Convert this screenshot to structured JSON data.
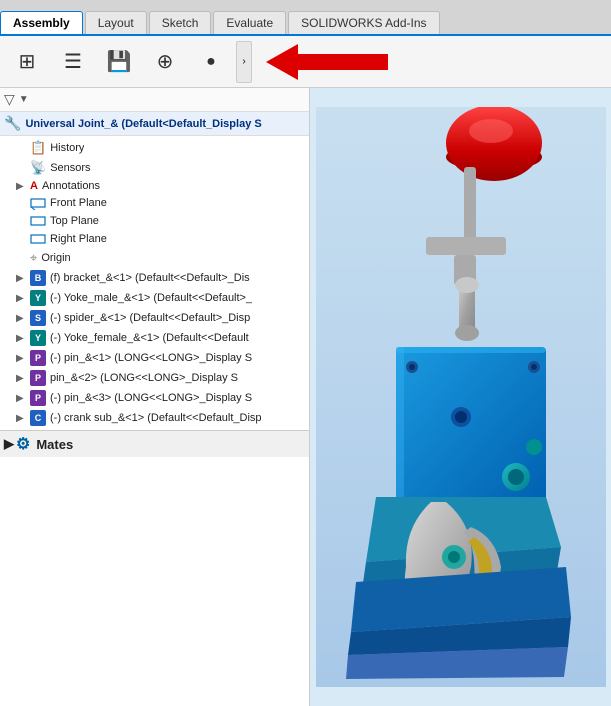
{
  "tabs": [
    {
      "label": "Assembly",
      "active": true
    },
    {
      "label": "Layout",
      "active": false
    },
    {
      "label": "Sketch",
      "active": false
    },
    {
      "label": "Evaluate",
      "active": false
    },
    {
      "label": "SOLIDWORKS Add-Ins",
      "active": false
    }
  ],
  "toolbar": {
    "buttons": [
      {
        "name": "view-selector",
        "icon": "⊞",
        "label": ""
      },
      {
        "name": "options",
        "icon": "☰",
        "label": ""
      },
      {
        "name": "save",
        "icon": "💾",
        "label": ""
      },
      {
        "name": "target",
        "icon": "⊕",
        "label": ""
      },
      {
        "name": "appearance",
        "icon": "🎨",
        "label": ""
      }
    ],
    "expand_label": "›"
  },
  "filter": {
    "icon": "▼",
    "label": "▼"
  },
  "tree": {
    "root_label": "Universal Joint_&  (Default<Default_Display S",
    "items": [
      {
        "type": "history",
        "label": "History",
        "icon": "📋",
        "indent": 1,
        "expandable": false
      },
      {
        "type": "sensors",
        "label": "Sensors",
        "icon": "📡",
        "indent": 1,
        "expandable": false
      },
      {
        "type": "annotations",
        "label": "Annotations",
        "icon": "A",
        "indent": 1,
        "expandable": true
      },
      {
        "type": "plane",
        "label": "Front Plane",
        "icon": "plane",
        "indent": 1,
        "expandable": false
      },
      {
        "type": "plane",
        "label": "Top Plane",
        "icon": "plane",
        "indent": 1,
        "expandable": false
      },
      {
        "type": "plane",
        "label": "Right Plane",
        "icon": "plane",
        "indent": 1,
        "expandable": false
      },
      {
        "type": "origin",
        "label": "Origin",
        "icon": "⌖",
        "indent": 1,
        "expandable": false
      },
      {
        "type": "component",
        "label": "(f) bracket_&<1> (Default<<Default>_Dis",
        "icon": "comp-blue",
        "indent": 1,
        "expandable": true
      },
      {
        "type": "component",
        "label": "(-) Yoke_male_&<1> (Default<<Default>_",
        "icon": "comp-teal",
        "indent": 1,
        "expandable": true
      },
      {
        "type": "component",
        "label": "(-) spider_&<1> (Default<<Default>_Disp",
        "icon": "comp-blue",
        "indent": 1,
        "expandable": true
      },
      {
        "type": "component",
        "label": "(-) Yoke_female_&<1> (Default<<Default",
        "icon": "comp-teal",
        "indent": 1,
        "expandable": true
      },
      {
        "type": "component",
        "label": "(-) pin_&<1> (LONG<<LONG>_Display S",
        "icon": "comp-purple",
        "indent": 1,
        "expandable": true
      },
      {
        "type": "component",
        "label": "pin_&<2> (LONG<<LONG>_Display S",
        "icon": "comp-purple",
        "indent": 1,
        "expandable": true
      },
      {
        "type": "component",
        "label": "(-) pin_&<3> (LONG<<LONG>_Display S",
        "icon": "comp-purple",
        "indent": 1,
        "expandable": true
      },
      {
        "type": "component",
        "label": "(-) crank sub_&<1> (Default<<Default_Disp",
        "icon": "comp-blue",
        "indent": 1,
        "expandable": true
      }
    ]
  },
  "mates": {
    "label": "Mates",
    "icon": "⚙"
  },
  "arrow": {
    "color": "#dd0000"
  }
}
